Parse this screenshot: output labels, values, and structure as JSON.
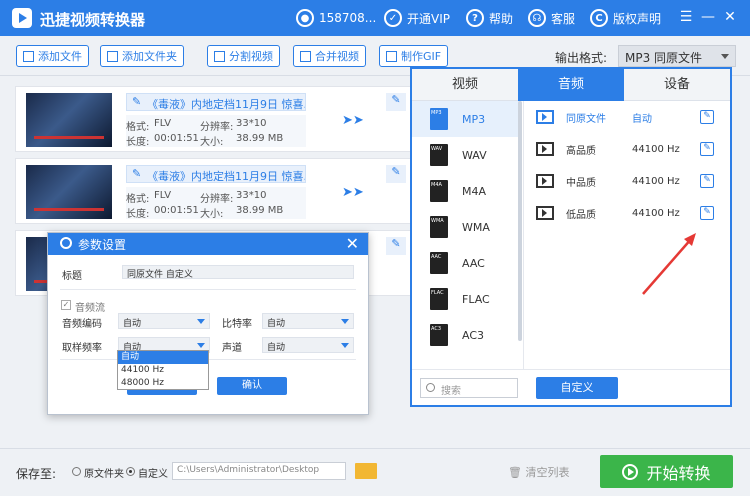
{
  "titlebar": {
    "title": "迅捷视频转换器",
    "account": "158708...",
    "vip": "开通VIP",
    "help": "帮助",
    "service": "客服",
    "copyright": "版权声明",
    "menu_glyph": "☰",
    "minimize_glyph": "—",
    "maximize_glyph": "☐",
    "close_glyph": "✕"
  },
  "toolbar": {
    "add_file": "添加文件",
    "add_folder": "添加文件夹",
    "split_video": "分割视频",
    "merge_video": "合并视频",
    "make_gif": "制作GIF",
    "output_format_label": "输出格式:",
    "output_format_value": "MP3  同原文件"
  },
  "files": [
    {
      "name": "《毒液》内地定档11月9日 惊喜.",
      "format_label": "格式:",
      "format": "FLV",
      "res_label": "分辨率:",
      "res": "33*10",
      "dur_label": "长度:",
      "dur": "00:01:51",
      "size_label": "大小:",
      "size": "38.99 MB"
    },
    {
      "name": "《毒液》内地定档11月9日 惊喜.",
      "format_label": "格式:",
      "format": "FLV",
      "res_label": "分辨率:",
      "res": "33*10",
      "dur_label": "长度:",
      "dur": "00:01:51",
      "size_label": "大小:",
      "size": "38.99 MB"
    },
    {
      "name": "",
      "format_label": "",
      "format": "",
      "res_label": "",
      "res": "",
      "dur_label": "",
      "dur": "",
      "size_label": "",
      "size": ""
    }
  ],
  "panel": {
    "tabs": [
      "视频",
      "音频",
      "设备"
    ],
    "formats": [
      "MP3",
      "WAV",
      "M4A",
      "WMA",
      "AAC",
      "FLAC",
      "AC3"
    ],
    "format_icon_labels": [
      "MP3",
      "WAV",
      "M4A",
      "WMA",
      "AAC",
      "FLAC",
      "AC3"
    ],
    "qualities": [
      {
        "name": "同原文件",
        "value": "自动"
      },
      {
        "name": "高品质",
        "value": "44100 Hz"
      },
      {
        "name": "中品质",
        "value": "44100 Hz"
      },
      {
        "name": "低品质",
        "value": "44100 Hz"
      }
    ],
    "search_placeholder": "搜索",
    "custom": "自定义"
  },
  "dialog": {
    "title": "参数设置",
    "name_label": "标题",
    "name_value": "同原文件 自定义",
    "audio_stream": "音频流",
    "audio_codec_label": "音频编码",
    "audio_codec": "自动",
    "bitrate_label": "比特率",
    "bitrate": "自动",
    "samplerate_label": "取样频率",
    "samplerate": "自动",
    "channel_label": "声道",
    "channel": "自动",
    "dropdown": [
      "自动",
      "44100 Hz",
      "48000 Hz"
    ],
    "cancel": "取消",
    "confirm": "确认"
  },
  "bottom": {
    "save_to": "保存至:",
    "opt_source": "原文件夹",
    "opt_custom": "自定义",
    "path": "C:\\Users\\Administrator\\Desktop",
    "clear": "清空列表",
    "start": "开始转换"
  },
  "colors": {
    "accent": "#2c7ee6",
    "start": "#3bb54a",
    "arrow": "#e53935"
  }
}
